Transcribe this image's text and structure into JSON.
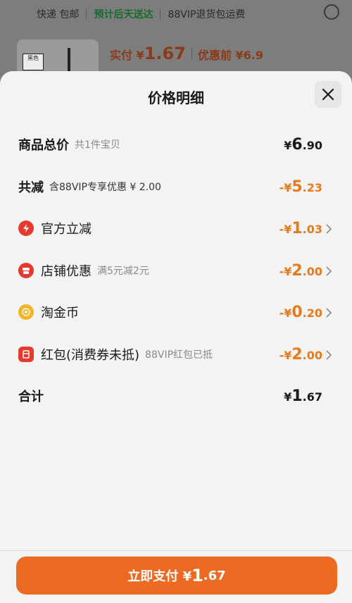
{
  "background": {
    "shipping_note": "快递 包邮",
    "delivery_note": "预计后天送达",
    "return_note": "88VIP退货包运费",
    "thumb_tag": "黑色",
    "paid_label": "实付 ¥",
    "paid_amount": "1.67",
    "before_discount": "优惠前 ¥6.9"
  },
  "sheet": {
    "title": "价格明细"
  },
  "rows": {
    "total": {
      "label": "商品总价",
      "note": "共1件宝贝",
      "currency": "¥",
      "int": "6",
      "dec": ".90"
    },
    "reduction": {
      "label": "共减",
      "note": "含88VIP专享优惠 ¥ 2.00",
      "currency": "-¥",
      "int": "5",
      "dec": ".23"
    },
    "official": {
      "label": "官方立减",
      "note": "",
      "currency": "-¥",
      "int": "1",
      "dec": ".03",
      "icon": "lightning-icon"
    },
    "shop": {
      "label": "店铺优惠",
      "note": "满5元减2元",
      "currency": "-¥",
      "int": "2",
      "dec": ".00",
      "icon": "shop-icon"
    },
    "coin": {
      "label": "淘金币",
      "note": "",
      "currency": "-¥",
      "int": "0",
      "dec": ".20",
      "icon": "coin-icon"
    },
    "redpacket": {
      "label": "红包(消费券未抵)",
      "note": "88VIP红包已抵",
      "currency": "-¥",
      "int": "2",
      "dec": ".00",
      "icon": "red-packet-icon"
    },
    "sum": {
      "label": "合计",
      "currency": "¥",
      "int": "1",
      "dec": ".67"
    }
  },
  "pay_button": {
    "label": "立即支付 ¥",
    "int": "1",
    "dec": ".67"
  },
  "colors": {
    "accent": "#ec6a22",
    "discount": "#e87a1c",
    "icon_red": "#e63a2e",
    "icon_gold": "#f0b428"
  }
}
